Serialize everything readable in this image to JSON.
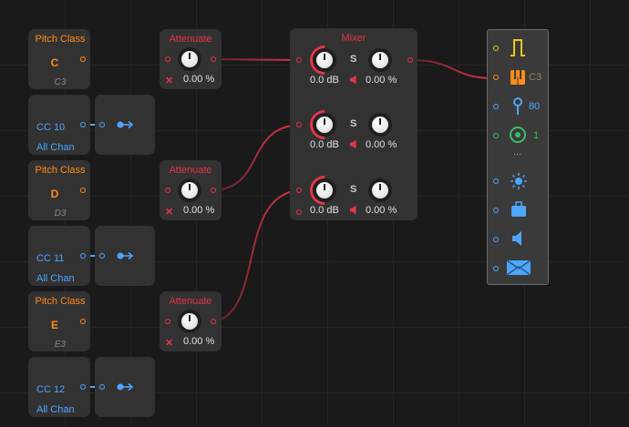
{
  "pitch_nodes": [
    {
      "title": "Pitch Class",
      "note": "C",
      "sub": "C3"
    },
    {
      "title": "Pitch Class",
      "note": "D",
      "sub": "D3"
    },
    {
      "title": "Pitch Class",
      "note": "E",
      "sub": "E3"
    }
  ],
  "cc_nodes": [
    {
      "label": "CC 10",
      "sub": "All Chan"
    },
    {
      "label": "CC 11",
      "sub": "All Chan"
    },
    {
      "label": "CC 12",
      "sub": "All Chan"
    }
  ],
  "attenuate_nodes": [
    {
      "title": "Attenuate",
      "value": "0.00 %"
    },
    {
      "title": "Attenuate",
      "value": "0.00 %"
    },
    {
      "title": "Attenuate",
      "value": "0.00 %"
    }
  ],
  "mixer": {
    "title": "Mixer",
    "channels": [
      {
        "gain": "0.0 dB",
        "solo": "S",
        "pan": "0.00 %"
      },
      {
        "gain": "0.0 dB",
        "solo": "S",
        "pan": "0.00 %"
      },
      {
        "gain": "0.0 dB",
        "solo": "S",
        "pan": "0.00 %"
      }
    ]
  },
  "output_panel": {
    "pitch_value": "C3",
    "velocity_value": "80",
    "channel_value": "1",
    "more": "..."
  },
  "colors": {
    "pitch": "#ff8c1a",
    "cc": "#4da6ff",
    "audio": "#e5354a",
    "gate": "#f0c419",
    "green": "#3dbb6a"
  }
}
